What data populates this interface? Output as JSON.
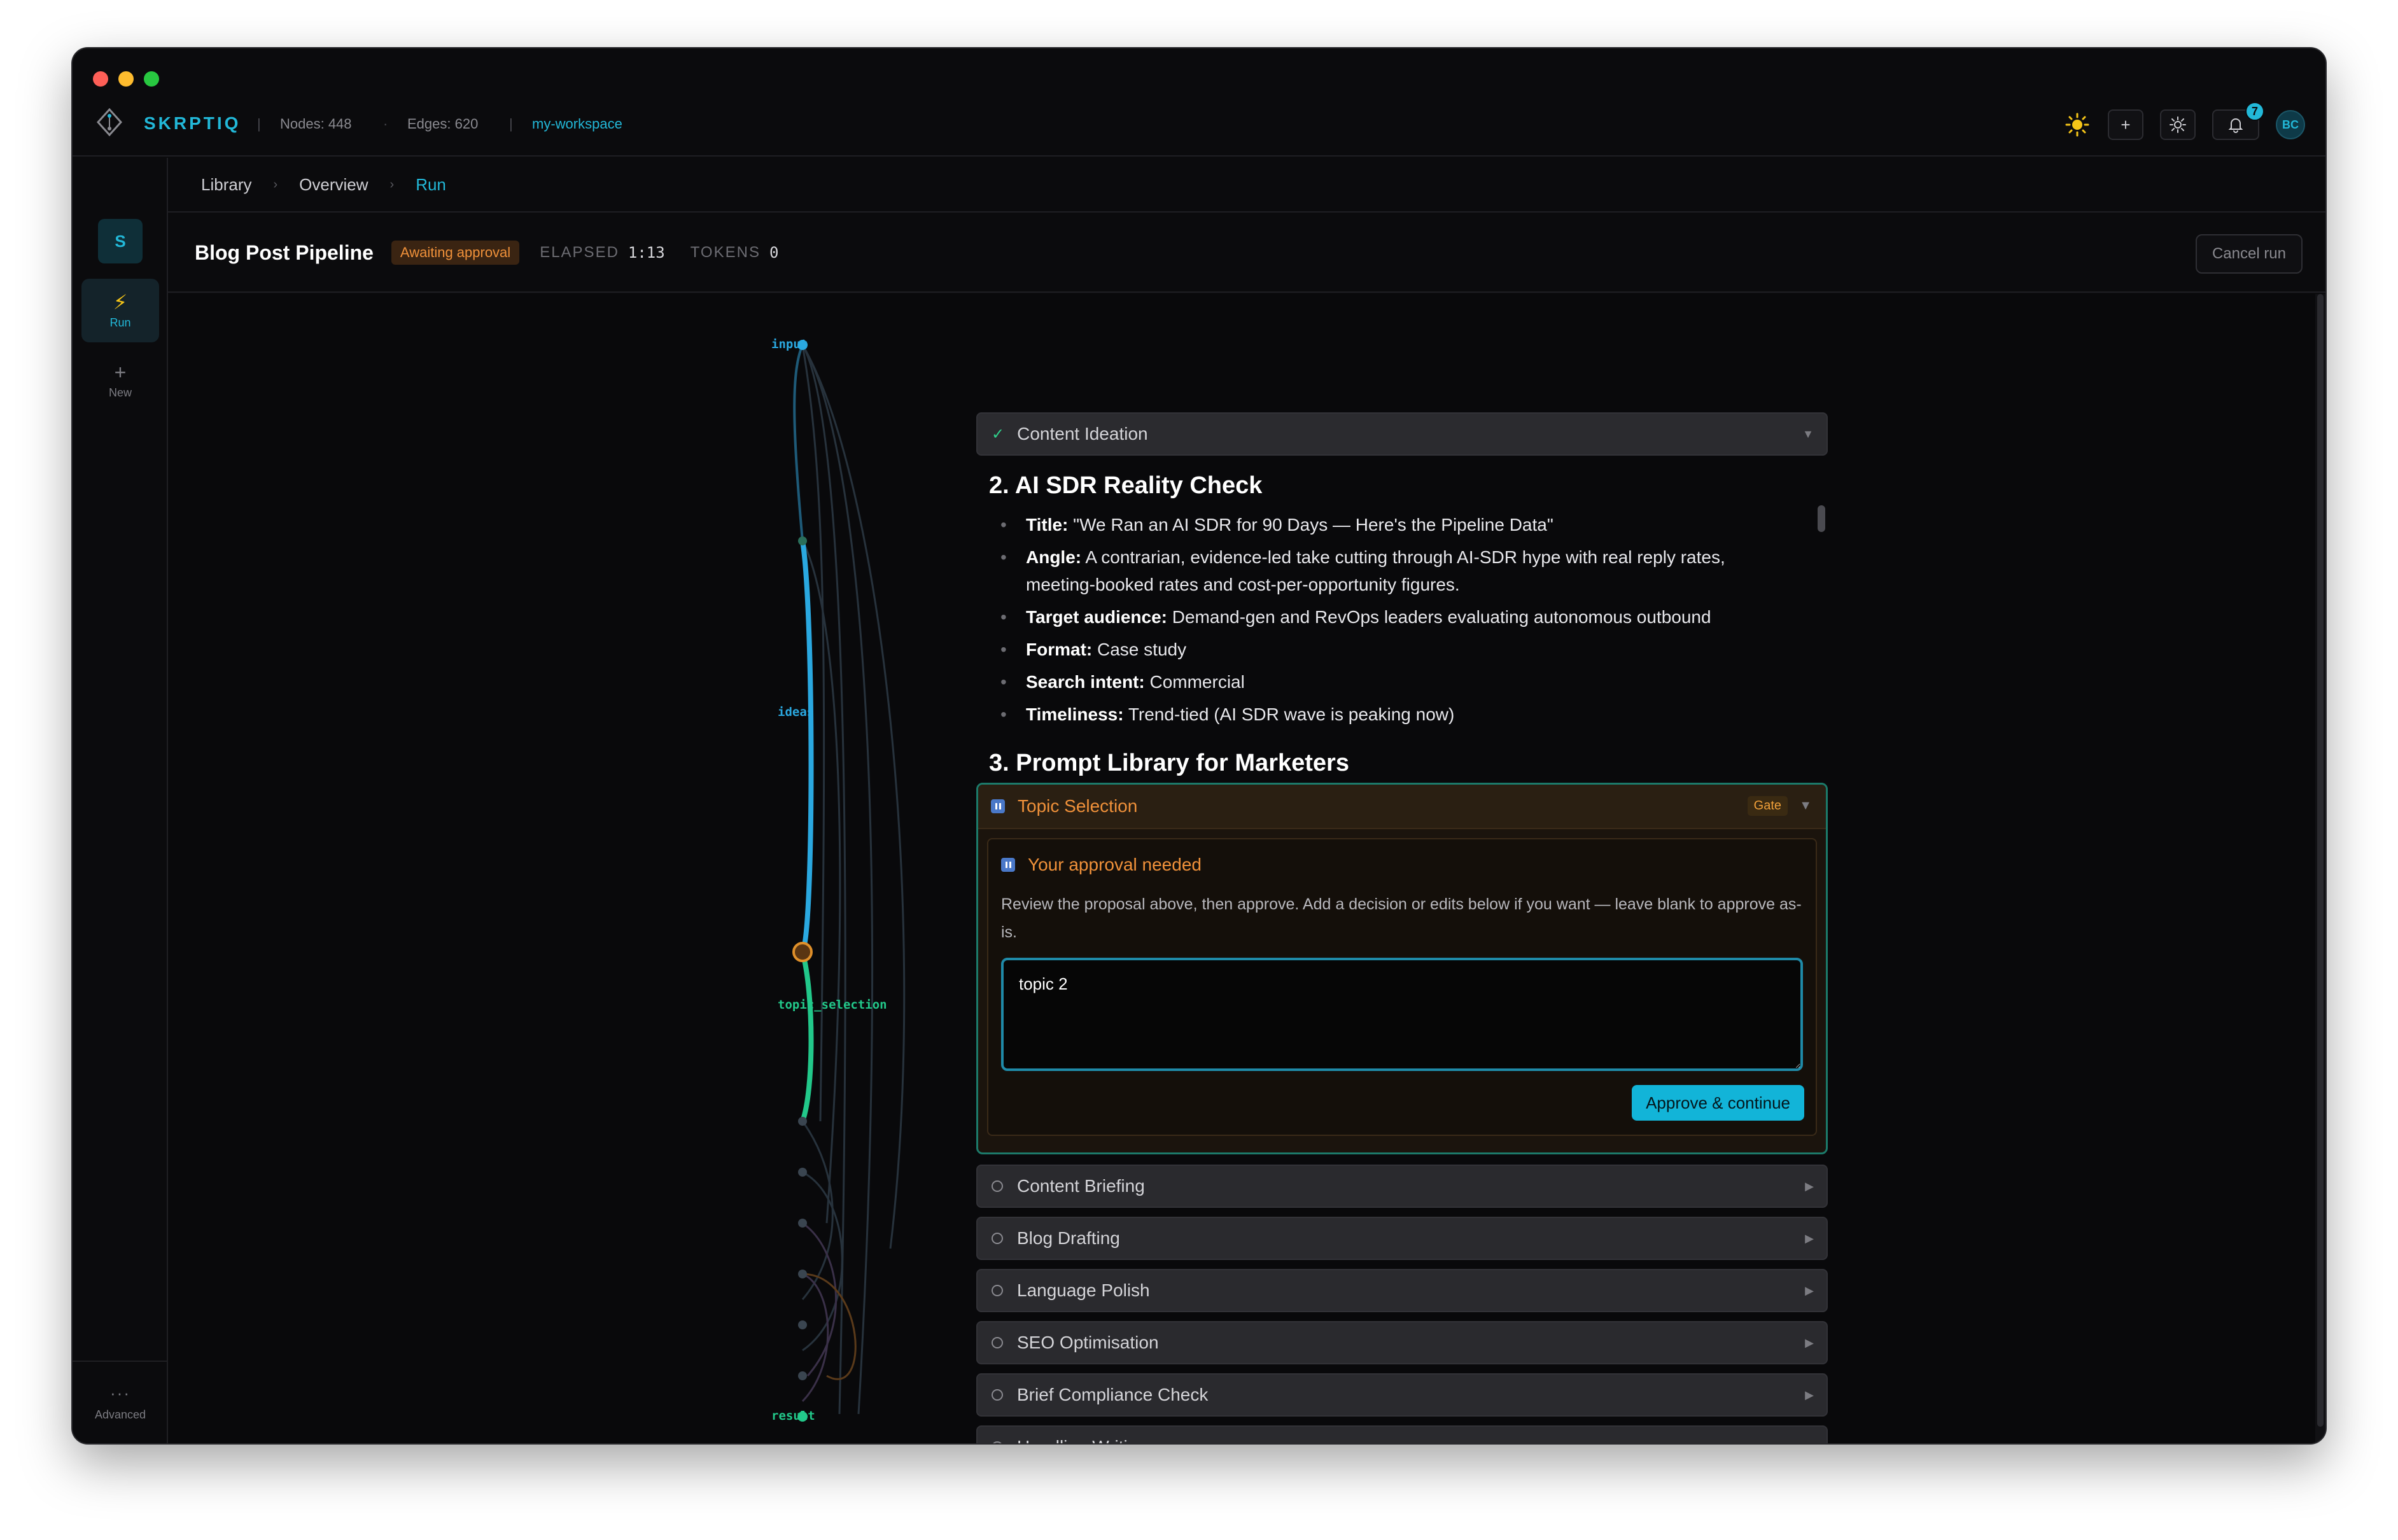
{
  "app": {
    "brand": "SKRPTIQ",
    "nodes": "Nodes: 448",
    "edges": "Edges: 620",
    "workspace": "my-workspace",
    "notifications": "7",
    "avatar": "BC"
  },
  "sidebar": {
    "workspace_initial": "S",
    "items": [
      {
        "label": "Run",
        "icon": "lightning-icon"
      },
      {
        "label": "New",
        "icon": "plus-icon"
      }
    ],
    "advanced": "Advanced"
  },
  "breadcrumb": [
    "Library",
    "Overview",
    "Run"
  ],
  "run": {
    "title": "Blog Post Pipeline",
    "status": "Awaiting approval",
    "elapsed_label": "ELAPSED",
    "elapsed": "1:13",
    "tokens_label": "TOKENS",
    "tokens": "0",
    "cancel": "Cancel run"
  },
  "graph": {
    "labels": [
      "input",
      "ideas",
      "topic_selection",
      "result"
    ],
    "colors": {
      "active": "#2aa8e0",
      "selection": "#22c88a",
      "current": "#e0902a",
      "muted": "#3a4550"
    }
  },
  "steps": {
    "completed": {
      "label": "Content Ideation"
    },
    "content": {
      "heading": "2. AI SDR Reality Check",
      "bullets": [
        {
          "k": "Title:",
          "v": " \"We Ran an AI SDR for 90 Days — Here's the Pipeline Data\""
        },
        {
          "k": "Angle:",
          "v": " A contrarian, evidence-led take cutting through AI-SDR hype with real reply rates, meeting-booked rates and cost-per-opportunity figures."
        },
        {
          "k": "Target audience:",
          "v": " Demand-gen and RevOps leaders evaluating autonomous outbound"
        },
        {
          "k": "Format:",
          "v": " Case study"
        },
        {
          "k": "Search intent:",
          "v": " Commercial"
        },
        {
          "k": "Timeliness:",
          "v": " Trend-tied (AI SDR wave is peaking now)"
        }
      ],
      "next_heading": "3. Prompt Library for Marketers"
    },
    "gate": {
      "label": "Topic Selection",
      "tag": "Gate",
      "approval_title": "Your approval needed",
      "approval_desc": "Review the proposal above, then approve. Add a decision or edits below if you want — leave blank to approve as-is.",
      "input_value": "topic 2",
      "approve": "Approve & continue"
    },
    "pending": [
      "Content Briefing",
      "Blog Drafting",
      "Language Polish",
      "SEO Optimisation",
      "Brief Compliance Check",
      "Headline Writing"
    ]
  }
}
